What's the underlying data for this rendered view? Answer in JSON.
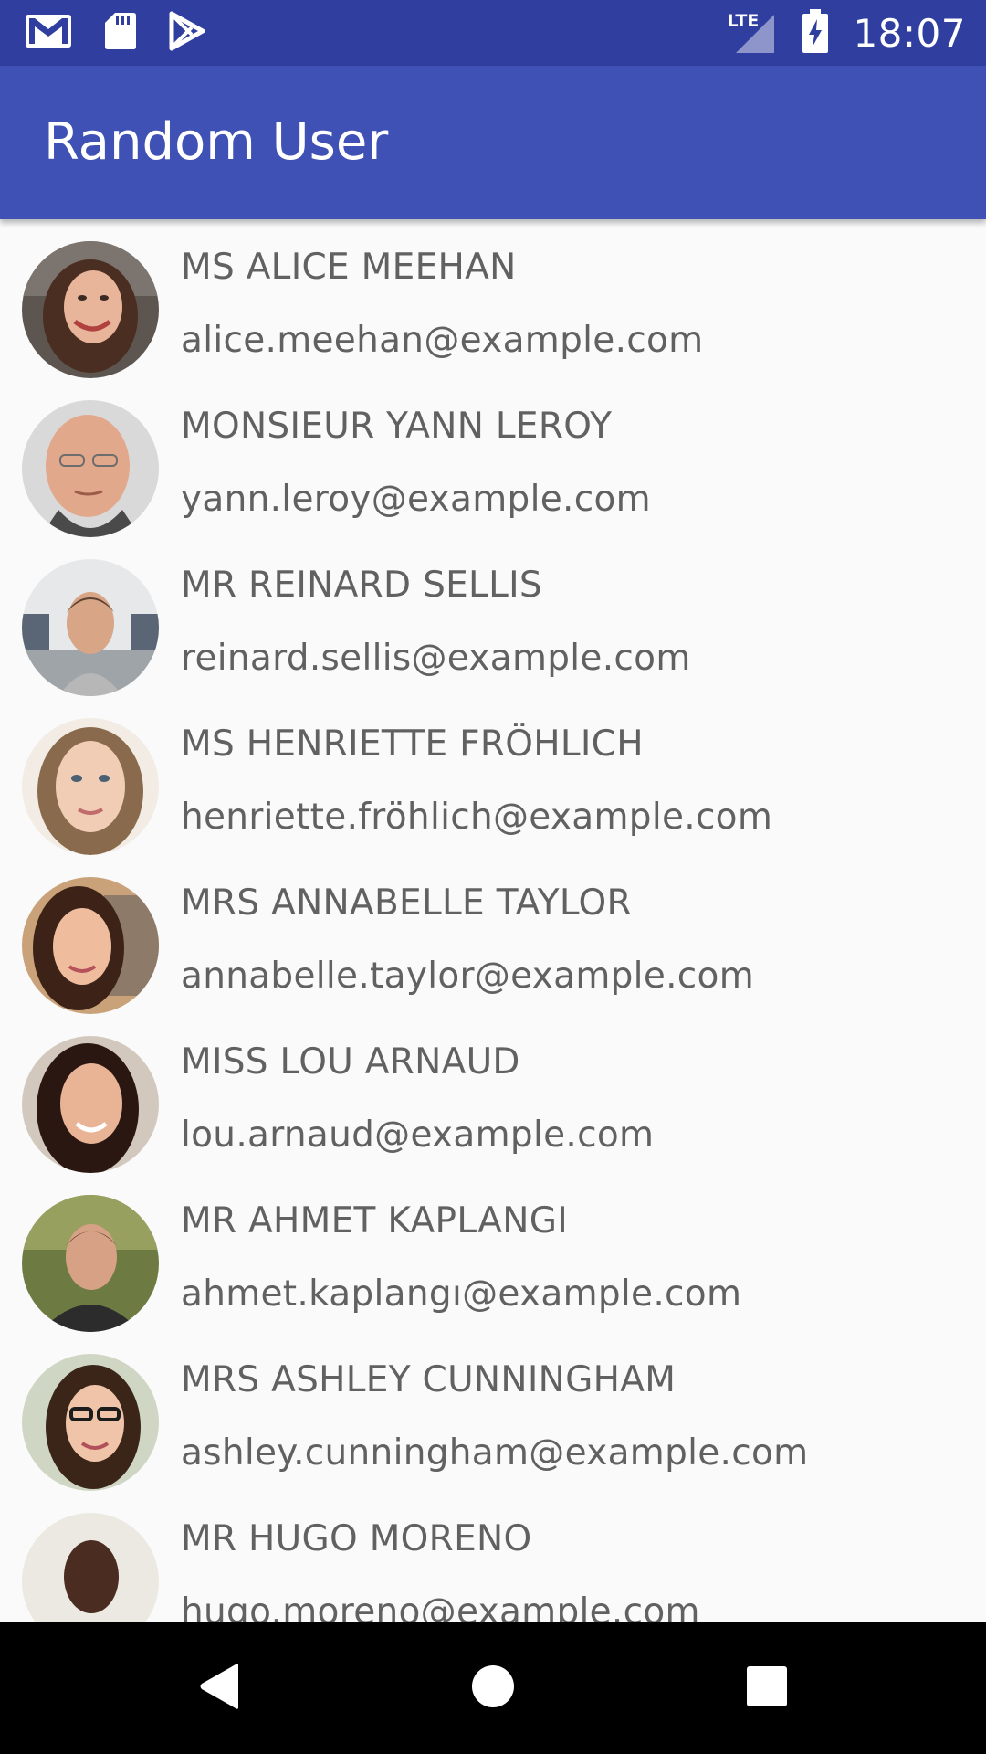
{
  "status_bar": {
    "time": "18:07",
    "network": "LTE",
    "left_icons": [
      "gmail-icon",
      "sd-card-icon",
      "play-store-icon"
    ],
    "background_color": "#303f9f"
  },
  "app_bar": {
    "title": "Random User",
    "background_color": "#3f51b5"
  },
  "users": [
    {
      "name": "MS ALICE MEEHAN",
      "email": "alice.meehan@example.com"
    },
    {
      "name": "MONSIEUR YANN LEROY",
      "email": "yann.leroy@example.com"
    },
    {
      "name": "MR REINARD SELLIS",
      "email": "reinard.sellis@example.com"
    },
    {
      "name": "MS HENRIETTE FRÖHLICH",
      "email": "henriette.fröhlich@example.com"
    },
    {
      "name": "MRS ANNABELLE TAYLOR",
      "email": "annabelle.taylor@example.com"
    },
    {
      "name": "MISS LOU ARNAUD",
      "email": "lou.arnaud@example.com"
    },
    {
      "name": "MR AHMET KAPLANGI",
      "email": "ahmet.kaplangı@example.com"
    },
    {
      "name": "MRS ASHLEY CUNNINGHAM",
      "email": "ashley.cunningham@example.com"
    },
    {
      "name": "MR HUGO MORENO",
      "email": "hugo.moreno@example.com"
    }
  ],
  "nav_bar": {
    "buttons": [
      "back-icon",
      "home-icon",
      "recents-icon"
    ]
  }
}
